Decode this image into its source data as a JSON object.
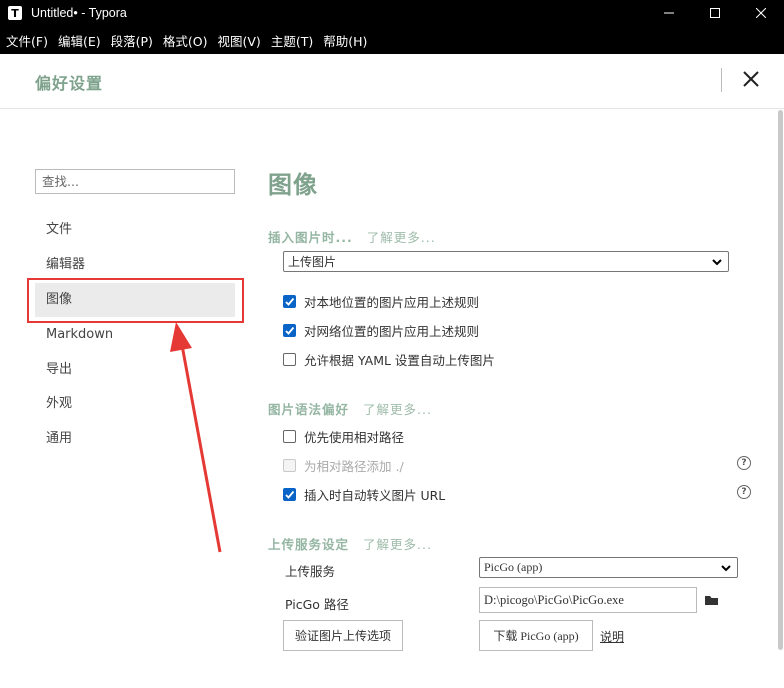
{
  "window": {
    "title": "Untitled• - Typora",
    "icon_letter": "T"
  },
  "menu": [
    "文件(F)",
    "编辑(E)",
    "段落(P)",
    "格式(O)",
    "视图(V)",
    "主题(T)",
    "帮助(H)"
  ],
  "prefs": {
    "title": "偏好设置"
  },
  "sidebar": {
    "search_placeholder": "查找...",
    "items": [
      {
        "label": "文件",
        "active": false
      },
      {
        "label": "编辑器",
        "active": false
      },
      {
        "label": "图像",
        "active": true
      },
      {
        "label": "Markdown",
        "active": false
      },
      {
        "label": "导出",
        "active": false
      },
      {
        "label": "外观",
        "active": false
      },
      {
        "label": "通用",
        "active": false
      }
    ]
  },
  "main": {
    "section_title": "图像",
    "learn_more": "了解更多...",
    "insert": {
      "heading": "插入图片时...",
      "select_value": "上传图片",
      "options": [
        {
          "label": "对本地位置的图片应用上述规则",
          "checked": true
        },
        {
          "label": "对网络位置的图片应用上述规则",
          "checked": true
        },
        {
          "label": "允许根据 YAML 设置自动上传图片",
          "checked": false
        }
      ]
    },
    "syntax": {
      "heading": "图片语法偏好",
      "options": [
        {
          "label": "优先使用相对路径",
          "checked": false,
          "disabled": false
        },
        {
          "label": "为相对路径添加 ./",
          "checked": false,
          "disabled": true
        },
        {
          "label": "插入时自动转义图片 URL",
          "checked": true,
          "disabled": false
        }
      ],
      "help_glyph": "?"
    },
    "upload": {
      "heading": "上传服务设定",
      "service_label": "上传服务",
      "service_value": "PicGo (app)",
      "path_label": "PicGo 路径",
      "path_value": "D:\\picogo\\PicGo\\PicGo.exe",
      "verify_button": "验证图片上传选项",
      "download_button": "下载 PicGo (app)",
      "help_link": "说明"
    }
  },
  "colors": {
    "accent": "#7fa28d",
    "checkbox": "#0a64c8",
    "annotation": "#e53935"
  }
}
